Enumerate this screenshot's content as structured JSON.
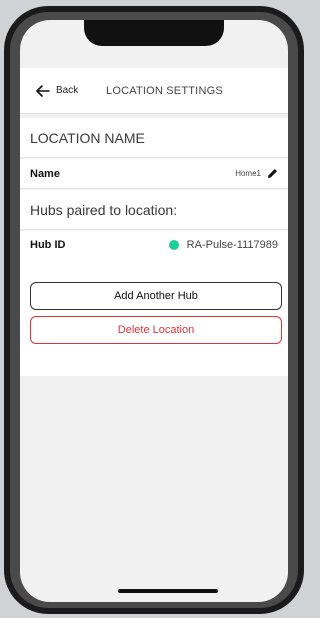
{
  "header": {
    "back_label": "Back",
    "title": "LOCATION SETTINGS"
  },
  "location_section": {
    "title": "LOCATION NAME",
    "name_label": "Name",
    "name_value": "Home1"
  },
  "hubs_section": {
    "title": "Hubs paired to location:",
    "hub_label": "Hub ID",
    "hub_value": "RA-Pulse-1117989",
    "hub_status_color": "#1ecf9a"
  },
  "actions": {
    "add_hub_label": "Add Another Hub",
    "delete_label": "Delete Location",
    "danger_color": "#e0323a"
  }
}
